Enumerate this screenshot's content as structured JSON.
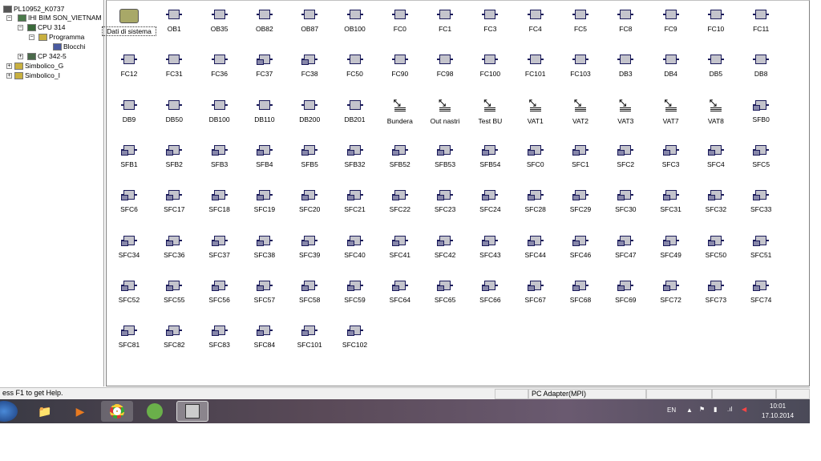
{
  "tree": [
    {
      "label": "PL10952_K0737",
      "icon": "project-icon"
    },
    {
      "label": "IHI BIM SON_VIETNAM",
      "icon": "station-icon"
    },
    {
      "label": "CPU 314",
      "icon": "cpu-icon"
    },
    {
      "label": "Programma",
      "icon": "s7-program-icon"
    },
    {
      "label": "Blocchi",
      "icon": "blocks-folder-icon"
    },
    {
      "label": "CP 342-5",
      "icon": "cp-module-icon"
    },
    {
      "label": "Simbolico_G",
      "icon": "s7-program-icon"
    },
    {
      "label": "Simbolico_I",
      "icon": "s7-program-icon"
    }
  ],
  "rows": [
    [
      [
        "Dati di sistema",
        "f"
      ],
      [
        "OB1",
        "b"
      ],
      [
        "OB35",
        "b"
      ],
      [
        "OB82",
        "b"
      ],
      [
        "OB87",
        "b"
      ],
      [
        "OB100",
        "b"
      ],
      [
        "FC0",
        "b"
      ],
      [
        "FC1",
        "b"
      ],
      [
        "FC3",
        "b"
      ],
      [
        "FC4",
        "b"
      ],
      [
        "FC5",
        "b"
      ],
      [
        "FC8",
        "b"
      ],
      [
        "FC9",
        "b"
      ],
      [
        "FC10",
        "b"
      ],
      [
        "FC11",
        "b"
      ]
    ],
    [
      [
        "FC12",
        "b"
      ],
      [
        "FC31",
        "b"
      ],
      [
        "FC36",
        "b"
      ],
      [
        "FC37",
        "s"
      ],
      [
        "FC38",
        "s"
      ],
      [
        "FC50",
        "b"
      ],
      [
        "FC90",
        "b"
      ],
      [
        "FC98",
        "b"
      ],
      [
        "FC100",
        "b"
      ],
      [
        "FC101",
        "b"
      ],
      [
        "FC103",
        "b"
      ],
      [
        "DB3",
        "b"
      ],
      [
        "DB4",
        "b"
      ],
      [
        "DB5",
        "b"
      ],
      [
        "DB8",
        "b"
      ]
    ],
    [
      [
        "DB9",
        "b"
      ],
      [
        "DB50",
        "b"
      ],
      [
        "DB100",
        "b"
      ],
      [
        "DB110",
        "b"
      ],
      [
        "DB200",
        "b"
      ],
      [
        "DB201",
        "b"
      ],
      [
        "Bundera",
        "v"
      ],
      [
        "Out nastri",
        "v"
      ],
      [
        "Test BU",
        "v"
      ],
      [
        "VAT1",
        "v"
      ],
      [
        "VAT2",
        "v"
      ],
      [
        "VAT3",
        "v"
      ],
      [
        "VAT7",
        "v"
      ],
      [
        "VAT8",
        "v"
      ],
      [
        "SFB0",
        "s"
      ]
    ],
    [
      [
        "SFB1",
        "s"
      ],
      [
        "SFB2",
        "s"
      ],
      [
        "SFB3",
        "s"
      ],
      [
        "SFB4",
        "s"
      ],
      [
        "SFB5",
        "s"
      ],
      [
        "SFB32",
        "s"
      ],
      [
        "SFB52",
        "s"
      ],
      [
        "SFB53",
        "s"
      ],
      [
        "SFB54",
        "s"
      ],
      [
        "SFC0",
        "s"
      ],
      [
        "SFC1",
        "s"
      ],
      [
        "SFC2",
        "s"
      ],
      [
        "SFC3",
        "s"
      ],
      [
        "SFC4",
        "s"
      ],
      [
        "SFC5",
        "s"
      ]
    ],
    [
      [
        "SFC6",
        "s"
      ],
      [
        "SFC17",
        "s"
      ],
      [
        "SFC18",
        "s"
      ],
      [
        "SFC19",
        "s"
      ],
      [
        "SFC20",
        "s"
      ],
      [
        "SFC21",
        "s"
      ],
      [
        "SFC22",
        "s"
      ],
      [
        "SFC23",
        "s"
      ],
      [
        "SFC24",
        "s"
      ],
      [
        "SFC28",
        "s"
      ],
      [
        "SFC29",
        "s"
      ],
      [
        "SFC30",
        "s"
      ],
      [
        "SFC31",
        "s"
      ],
      [
        "SFC32",
        "s"
      ],
      [
        "SFC33",
        "s"
      ]
    ],
    [
      [
        "SFC34",
        "s"
      ],
      [
        "SFC36",
        "s"
      ],
      [
        "SFC37",
        "s"
      ],
      [
        "SFC38",
        "s"
      ],
      [
        "SFC39",
        "s"
      ],
      [
        "SFC40",
        "s"
      ],
      [
        "SFC41",
        "s"
      ],
      [
        "SFC42",
        "s"
      ],
      [
        "SFC43",
        "s"
      ],
      [
        "SFC44",
        "s"
      ],
      [
        "SFC46",
        "s"
      ],
      [
        "SFC47",
        "s"
      ],
      [
        "SFC49",
        "s"
      ],
      [
        "SFC50",
        "s"
      ],
      [
        "SFC51",
        "s"
      ]
    ],
    [
      [
        "SFC52",
        "s"
      ],
      [
        "SFC55",
        "s"
      ],
      [
        "SFC56",
        "s"
      ],
      [
        "SFC57",
        "s"
      ],
      [
        "SFC58",
        "s"
      ],
      [
        "SFC59",
        "s"
      ],
      [
        "SFC64",
        "s"
      ],
      [
        "SFC65",
        "s"
      ],
      [
        "SFC66",
        "s"
      ],
      [
        "SFC67",
        "s"
      ],
      [
        "SFC68",
        "s"
      ],
      [
        "SFC69",
        "s"
      ],
      [
        "SFC72",
        "s"
      ],
      [
        "SFC73",
        "s"
      ],
      [
        "SFC74",
        "s"
      ]
    ],
    [
      [
        "SFC81",
        "s"
      ],
      [
        "SFC82",
        "s"
      ],
      [
        "SFC83",
        "s"
      ],
      [
        "SFC84",
        "s"
      ],
      [
        "SFC101",
        "s"
      ],
      [
        "SFC102",
        "s"
      ]
    ]
  ],
  "status": {
    "help": "ess F1 to get Help.",
    "adapter": "PC Adapter(MPI)"
  },
  "taskbar": {
    "lang": "EN",
    "time": "10:01",
    "date": "17.10.2014"
  }
}
